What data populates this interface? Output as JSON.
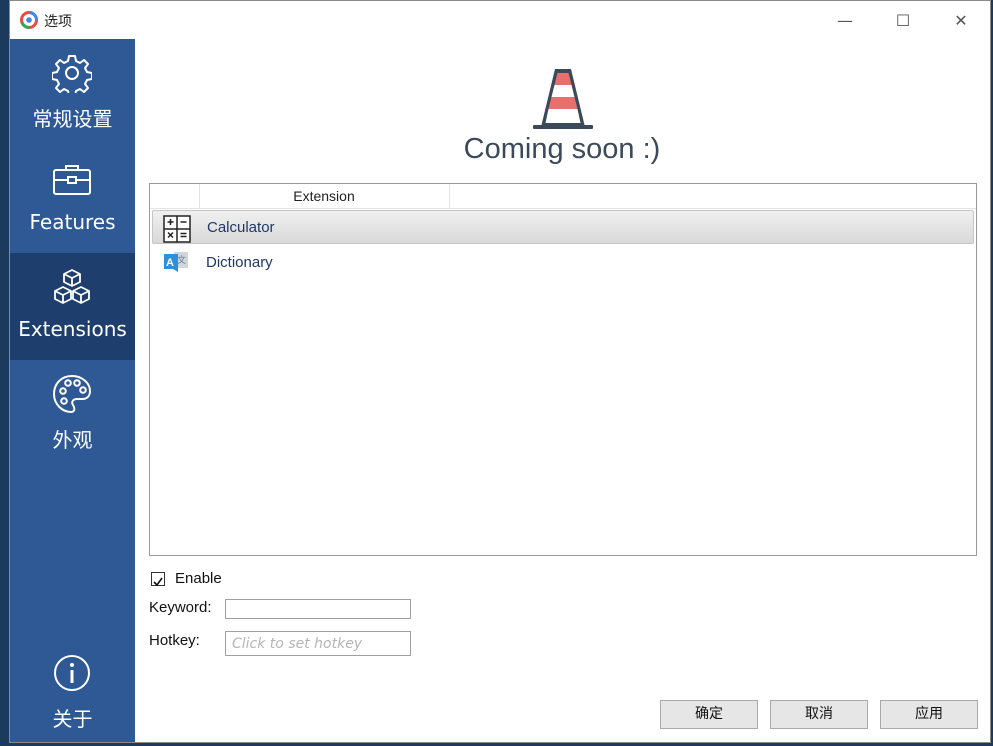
{
  "window": {
    "title": "选项",
    "controls": {
      "minimize": "—",
      "maximize": "☐",
      "close": "✕"
    }
  },
  "sidebar": {
    "items": [
      {
        "label": "常规设置",
        "icon": "gear-icon",
        "active": false
      },
      {
        "label": "Features",
        "icon": "toolbox-icon",
        "active": false
      },
      {
        "label": "Extensions",
        "icon": "cubes-icon",
        "active": true
      },
      {
        "label": "外观",
        "icon": "palette-icon",
        "active": false
      },
      {
        "label": "关于",
        "icon": "info-icon",
        "active": false
      }
    ]
  },
  "main": {
    "banner_icon": "traffic-cone-icon",
    "banner_text": "Coming soon :)",
    "table": {
      "header": "Extension",
      "rows": [
        {
          "label": "Calculator",
          "icon": "calculator-icon",
          "selected": true
        },
        {
          "label": "Dictionary",
          "icon": "dictionary-icon",
          "selected": false
        }
      ]
    },
    "enable": {
      "label": "Enable",
      "checked": true
    },
    "keyword": {
      "label": "Keyword:",
      "value": ""
    },
    "hotkey": {
      "label": "Hotkey:",
      "placeholder": "Click to set hotkey"
    }
  },
  "buttons": {
    "ok": "确定",
    "cancel": "取消",
    "apply": "应用"
  },
  "colors": {
    "sidebar_bg": "#2e5994",
    "sidebar_active": "#1e3f6e",
    "cone_red": "#e7706f",
    "cone_dark": "#3b4a5a",
    "row_text": "#1f3866"
  }
}
